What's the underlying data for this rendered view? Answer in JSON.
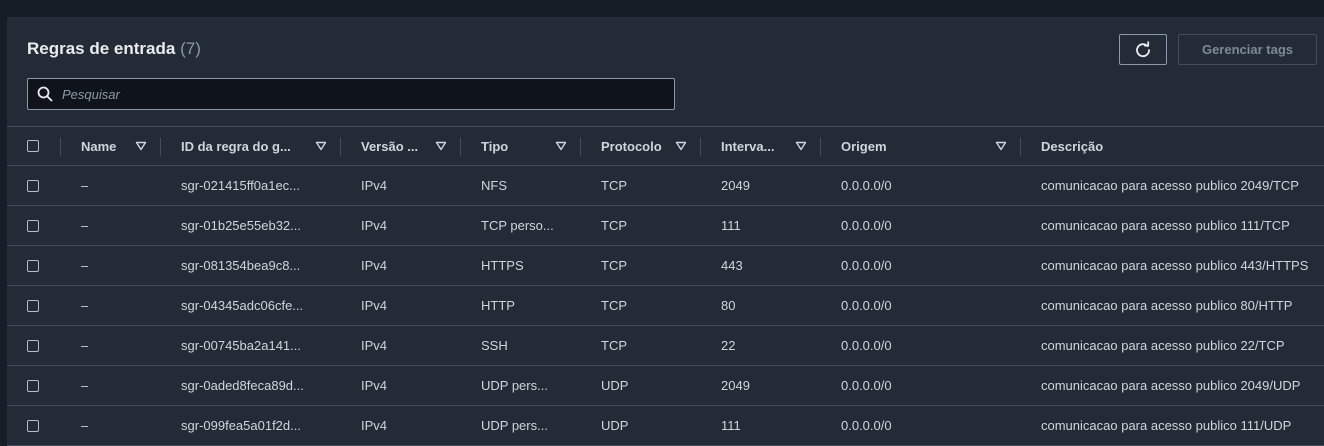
{
  "header": {
    "title": "Regras de entrada",
    "count": "(7)",
    "manage_tags_label": "Gerenciar tags"
  },
  "search": {
    "placeholder": "Pesquisar"
  },
  "columns": [
    "Name",
    "ID da regra do g...",
    "Versão ...",
    "Tipo",
    "Protocolo",
    "Interva...",
    "Origem",
    "Descrição"
  ],
  "rows": [
    [
      "–",
      "sgr-021415ff0a1ec...",
      "IPv4",
      "NFS",
      "TCP",
      "2049",
      "0.0.0.0/0",
      "comunicacao para acesso publico 2049/TCP"
    ],
    [
      "–",
      "sgr-01b25e55eb32...",
      "IPv4",
      "TCP perso...",
      "TCP",
      "111",
      "0.0.0.0/0",
      "comunicacao para acesso publico 111/TCP"
    ],
    [
      "–",
      "sgr-081354bea9c8...",
      "IPv4",
      "HTTPS",
      "TCP",
      "443",
      "0.0.0.0/0",
      "comunicacao para acesso publico 443/HTTPS"
    ],
    [
      "–",
      "sgr-04345adc06cfe...",
      "IPv4",
      "HTTP",
      "TCP",
      "80",
      "0.0.0.0/0",
      "comunicacao para acesso publico 80/HTTP"
    ],
    [
      "–",
      "sgr-00745ba2a141...",
      "IPv4",
      "SSH",
      "TCP",
      "22",
      "0.0.0.0/0",
      "comunicacao para acesso publico 22/TCP"
    ],
    [
      "–",
      "sgr-0aded8feca89d...",
      "IPv4",
      "UDP pers...",
      "UDP",
      "2049",
      "0.0.0.0/0",
      "comunicacao para acesso publico 2049/UDP"
    ],
    [
      "–",
      "sgr-099fea5a01f2d...",
      "IPv4",
      "UDP pers...",
      "UDP",
      "111",
      "0.0.0.0/0",
      "comunicacao para acesso publico 111/UDP"
    ]
  ],
  "icons": {
    "refresh": "refresh-icon",
    "search": "search-icon",
    "sort": "sort-caret-down-icon"
  }
}
